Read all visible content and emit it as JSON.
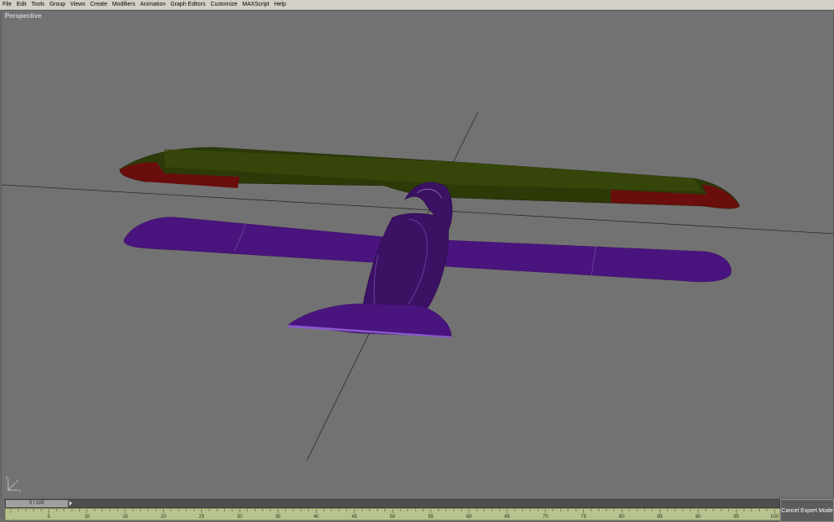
{
  "menu": {
    "items": [
      "File",
      "Edit",
      "Tools",
      "Group",
      "Views",
      "Create",
      "Modifiers",
      "Animation",
      "Graph Editors",
      "Customize",
      "MAXScript",
      "Help"
    ]
  },
  "viewport": {
    "label": "Perspective",
    "background": "#727272",
    "upper_wing_color": "#3a4a0a",
    "aileron_color": "#7a0f0f",
    "lower_wing_color": "#5a1a9a",
    "fuselage_color": "#4a1a7a"
  },
  "timeline": {
    "slider_label": "0 / 100",
    "ticks": [
      "5",
      "10",
      "15",
      "20",
      "25",
      "30",
      "35",
      "40",
      "45",
      "50",
      "55",
      "60",
      "65",
      "70",
      "75",
      "80",
      "85",
      "90",
      "95",
      "100"
    ]
  },
  "expert_button": {
    "label": "Cancel Expert Mode"
  },
  "axis": {
    "x": "x",
    "y": "y",
    "z": "z"
  }
}
